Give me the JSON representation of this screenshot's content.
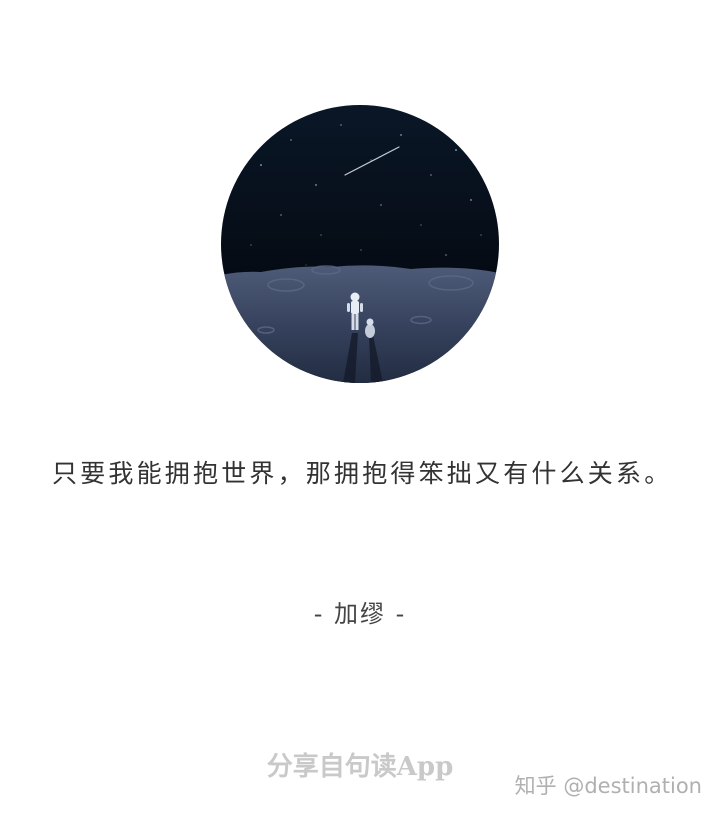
{
  "quote": {
    "text": "只要我能拥抱世界，那拥抱得笨拙又有什么关系。",
    "author": "- 加缪 -"
  },
  "footer": {
    "share_text": "分享自句读App"
  },
  "watermark": {
    "text": "知乎 @destination"
  },
  "illustration": {
    "icon": "astronaut-on-moon-illustration",
    "colors": {
      "sky": "#07101c",
      "moon_surface": "#3d4a66"
    }
  }
}
